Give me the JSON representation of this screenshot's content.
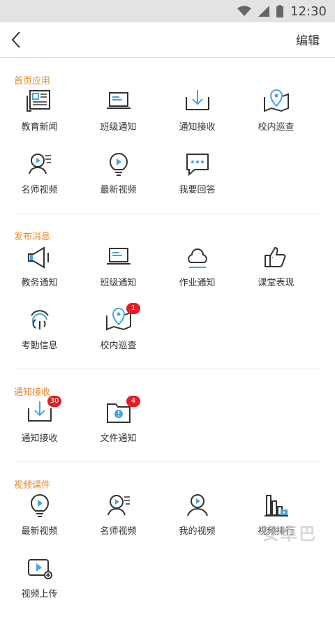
{
  "status": {
    "time": "12:30"
  },
  "header": {
    "edit_label": "编辑"
  },
  "sections": [
    {
      "title": "首页应用",
      "items": [
        {
          "label": "教育新闻"
        },
        {
          "label": "班级通知"
        },
        {
          "label": "通知接收"
        },
        {
          "label": "校内巡查"
        },
        {
          "label": "名师视频"
        },
        {
          "label": "最新视频"
        },
        {
          "label": "我要回答"
        }
      ]
    },
    {
      "title": "发布消息",
      "items": [
        {
          "label": "教务通知"
        },
        {
          "label": "班级通知"
        },
        {
          "label": "作业通知"
        },
        {
          "label": "课堂表现"
        },
        {
          "label": "考勤信息"
        },
        {
          "label": "校内巡查",
          "badge": "1"
        }
      ]
    },
    {
      "title": "通知接收",
      "items": [
        {
          "label": "通知接收",
          "badge": "30"
        },
        {
          "label": "文件通知",
          "badge": "4"
        }
      ]
    },
    {
      "title": "视频课件",
      "items": [
        {
          "label": "最新视频"
        },
        {
          "label": "名师视频"
        },
        {
          "label": "我的视频"
        },
        {
          "label": "视频排行"
        },
        {
          "label": "视频上传"
        }
      ]
    }
  ],
  "watermark": "安卓巴"
}
